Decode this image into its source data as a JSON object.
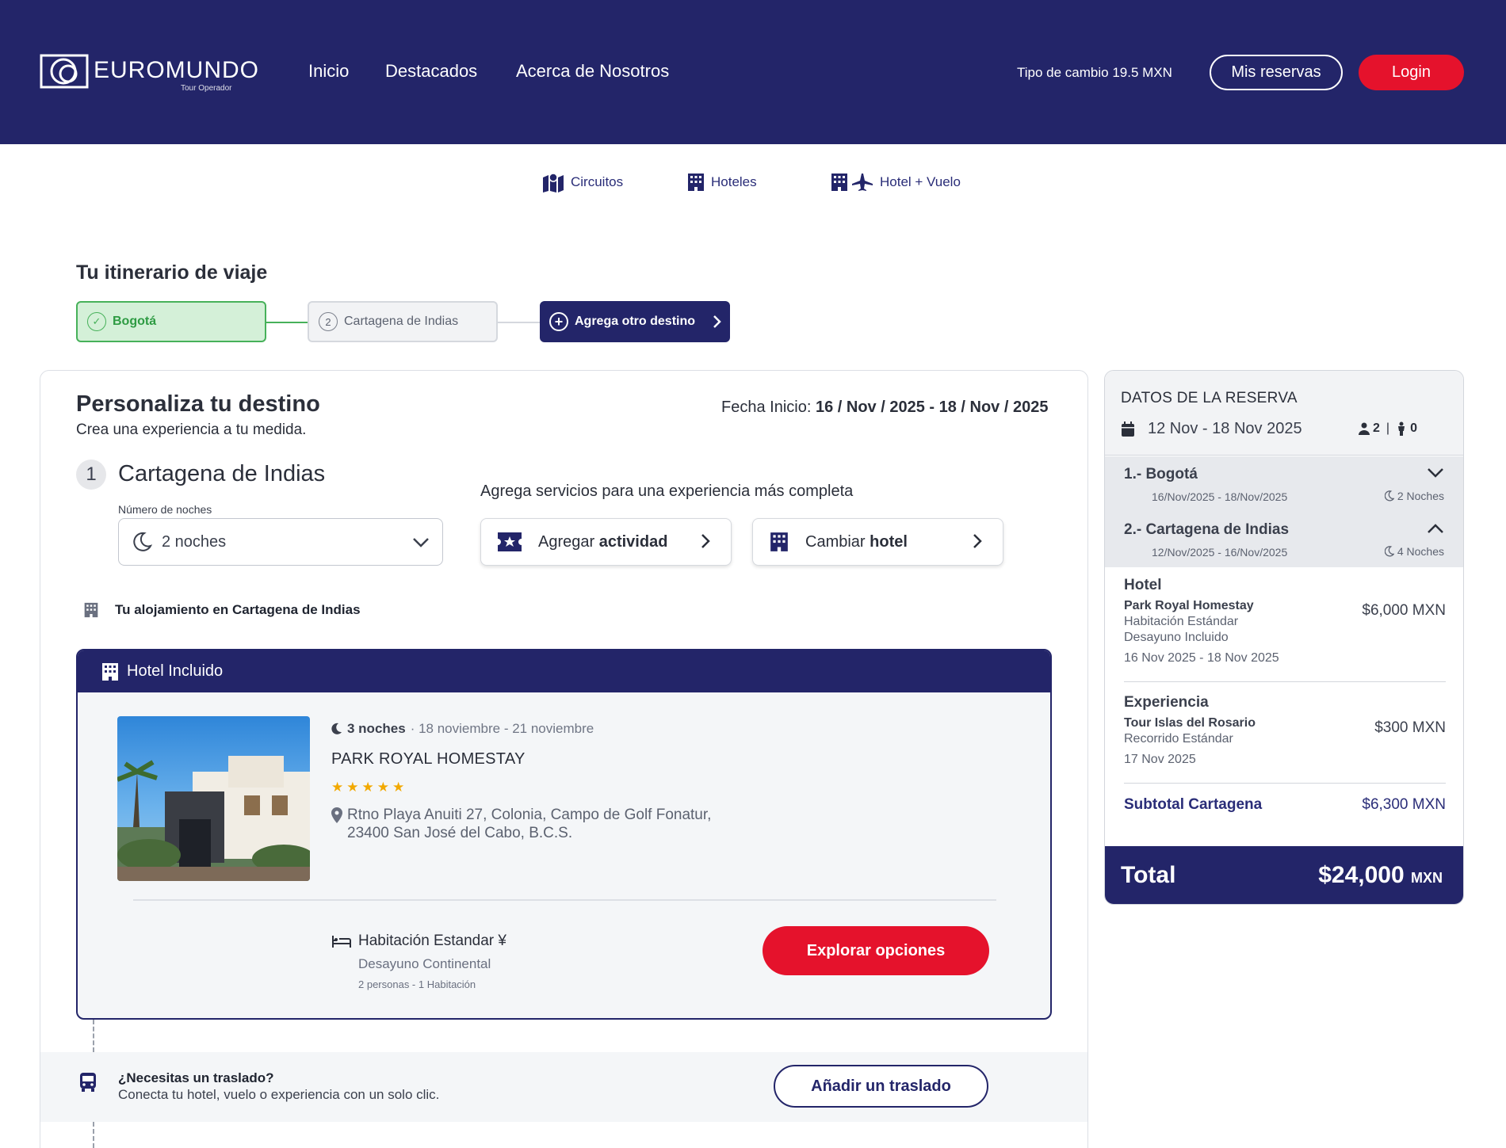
{
  "header": {
    "logo_text": "EUROMUNDO",
    "logo_sub": "Tour Operador",
    "nav": [
      "Inicio",
      "Destacados",
      "Acerca de Nosotros"
    ],
    "exchange_rate": "Tipo de cambio 19.5 MXN",
    "my_bookings": "Mis reservas",
    "login": "Login"
  },
  "product_tabs": [
    {
      "label": "Circuitos",
      "icon": "map-icon"
    },
    {
      "label": "Hoteles",
      "icon": "building-icon"
    },
    {
      "label": "Hotel + Vuelo",
      "icon": "building-plane-icon"
    }
  ],
  "itinerary": {
    "title": "Tu itinerario de viaje",
    "steps": [
      {
        "label": "Bogotá",
        "status": "done"
      },
      {
        "number": "2",
        "label": "Cartagena de Indias",
        "status": "pending"
      }
    ],
    "add_destination": "Agrega otro destino"
  },
  "customize": {
    "title": "Personaliza tu destino",
    "subtitle": "Crea una experiencia a tu medida.",
    "date_label": "Fecha Inicio:",
    "date_value": "16 / Nov / 2025 - 18 / Nov / 2025",
    "destination_number": "1",
    "destination_name": "Cartagena de Indias",
    "nights_label": "Número de noches",
    "nights_value": "2 noches",
    "services_heading": "Agrega servicios para una experiencia más completa",
    "add_activity_pre": "Agregar",
    "add_activity_bold": "actividad",
    "change_hotel_pre": "Cambiar",
    "change_hotel_bold": "hotel",
    "lodging_label": "Tu alojamiento en Cartagena de Indias"
  },
  "hotel": {
    "header": "Hotel Incluido",
    "nights": "3 noches",
    "dates": "· 18 noviembre - 21 noviembre",
    "name": "PARK ROYAL HOMESTAY",
    "stars": 5,
    "address_line1": "Rtno Playa Anuiti 27, Colonia, Campo de Golf Fonatur,",
    "address_line2": "23400 San José del Cabo, B.C.S.",
    "room_type": "Habitación Estandar ¥",
    "board": "Desayuno Continental",
    "occupancy": "2 personas - 1 Habitación",
    "explore": "Explorar opciones"
  },
  "transfer": {
    "question": "¿Necesitas un traslado?",
    "description": "Conecta tu hotel, vuelo o experiencia con un solo clic.",
    "button": "Añadir un traslado"
  },
  "summary": {
    "title": "DATOS DE LA RESERVA",
    "dates": "12 Nov - 18 Nov 2025",
    "adults": "2",
    "children": "0",
    "legs": [
      {
        "name": "1.- Bogotá",
        "dates": "16/Nov/2025 - 18/Nov/2025",
        "nights": "2 Noches",
        "expanded": false
      },
      {
        "name": "2.- Cartagena de Indias",
        "dates": "12/Nov/2025 - 16/Nov/2025",
        "nights": "4 Noches",
        "expanded": true
      }
    ],
    "hotel_item": {
      "title": "Hotel",
      "name": "Park Royal Homestay",
      "room": "Habitación Estándar",
      "board": "Desayuno Incluido",
      "dates": "16 Nov 2025 -  18 Nov 2025",
      "price": "$6,000 MXN"
    },
    "experience_item": {
      "title": "Experiencia",
      "name": "Tour Islas del Rosario",
      "detail": "Recorrido Estándar",
      "date": "17 Nov 2025",
      "price": "$300 MXN"
    },
    "subtotal_label": "Subtotal Cartagena",
    "subtotal_value": "$6,300 MXN",
    "total_label": "Total",
    "total_value": "$24,000",
    "total_currency": "MXN"
  },
  "colors": {
    "brand_navy": "#232569",
    "accent_red": "#e5122c",
    "success_green": "#47b15a",
    "star_gold": "#f2a900"
  }
}
